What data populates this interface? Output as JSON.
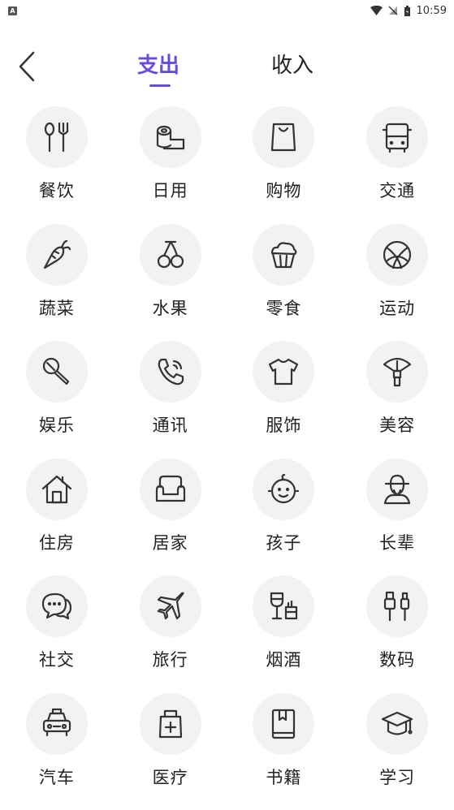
{
  "status_bar": {
    "app_badge": "A",
    "time": "10:59"
  },
  "header": {
    "back_icon": "chevron-left-icon",
    "tabs": [
      {
        "label": "支出",
        "active": true
      },
      {
        "label": "收入",
        "active": false
      }
    ],
    "accent_color": "#6a4cdc"
  },
  "categories": [
    {
      "label": "餐饮",
      "icon": "spoon-fork-icon"
    },
    {
      "label": "日用",
      "icon": "tissue-roll-icon"
    },
    {
      "label": "购物",
      "icon": "shopping-bag-icon"
    },
    {
      "label": "交通",
      "icon": "bus-icon"
    },
    {
      "label": "蔬菜",
      "icon": "carrot-icon"
    },
    {
      "label": "水果",
      "icon": "cherry-icon"
    },
    {
      "label": "零食",
      "icon": "cupcake-icon"
    },
    {
      "label": "运动",
      "icon": "basketball-icon"
    },
    {
      "label": "娱乐",
      "icon": "microphone-icon"
    },
    {
      "label": "通讯",
      "icon": "phone-icon"
    },
    {
      "label": "服饰",
      "icon": "tshirt-icon"
    },
    {
      "label": "美容",
      "icon": "makeup-brush-icon"
    },
    {
      "label": "住房",
      "icon": "house-icon"
    },
    {
      "label": "居家",
      "icon": "sofa-icon"
    },
    {
      "label": "孩子",
      "icon": "baby-face-icon"
    },
    {
      "label": "长辈",
      "icon": "elder-icon"
    },
    {
      "label": "社交",
      "icon": "chat-bubbles-icon"
    },
    {
      "label": "旅行",
      "icon": "airplane-icon"
    },
    {
      "label": "烟酒",
      "icon": "wine-cigarette-icon"
    },
    {
      "label": "数码",
      "icon": "usb-cable-icon"
    },
    {
      "label": "汽车",
      "icon": "car-icon"
    },
    {
      "label": "医疗",
      "icon": "medical-kit-icon"
    },
    {
      "label": "书籍",
      "icon": "book-icon"
    },
    {
      "label": "学习",
      "icon": "graduation-cap-icon"
    }
  ]
}
